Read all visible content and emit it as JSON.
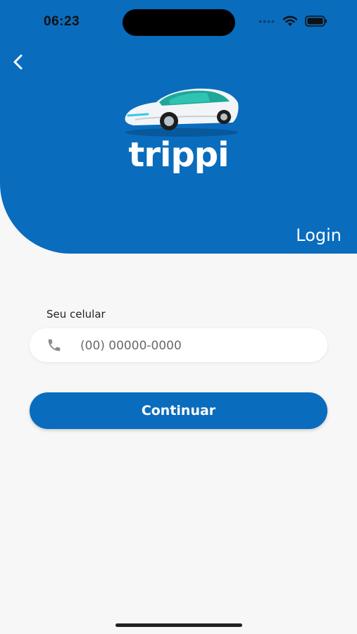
{
  "status_bar": {
    "time": "06:23"
  },
  "brand": {
    "name": "trippi"
  },
  "screen": {
    "title": "Login"
  },
  "form": {
    "phone_label": "Seu celular",
    "phone_placeholder": "(00) 00000-0000",
    "phone_value": "",
    "continue_label": "Continuar"
  },
  "colors": {
    "primary": "#0a6cbd",
    "background": "#f7f7f7"
  },
  "icons": [
    "back-arrow-icon",
    "phone-icon",
    "wifi-icon",
    "battery-icon",
    "signal-dots-icon",
    "car-logo-icon"
  ]
}
